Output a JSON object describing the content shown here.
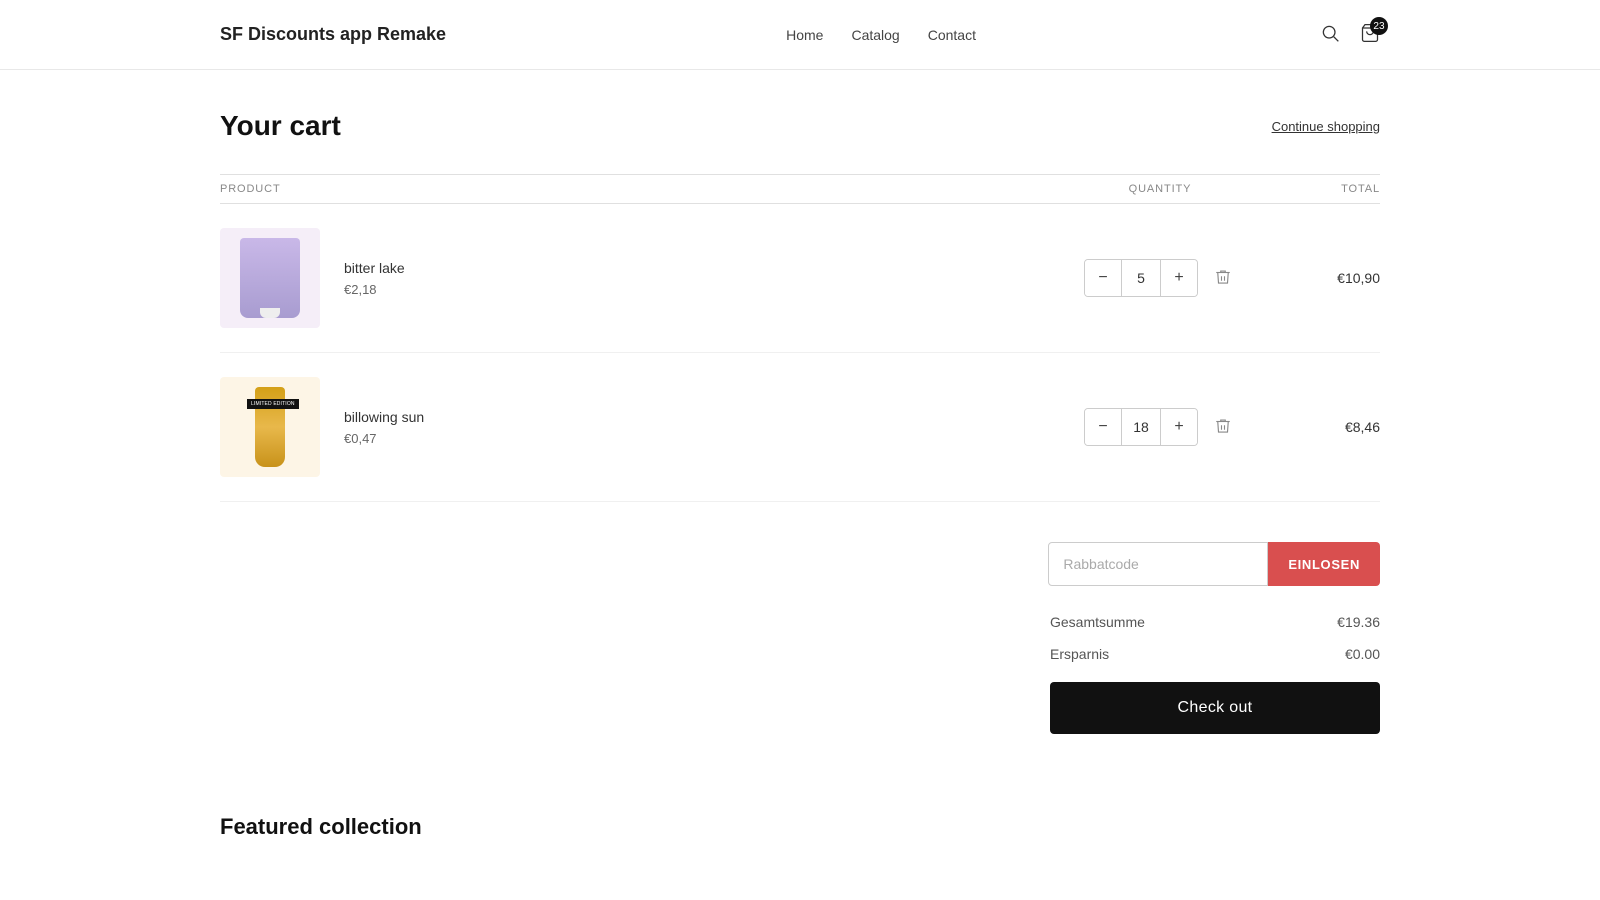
{
  "app": {
    "title": "SF Discounts app Remake"
  },
  "nav": {
    "links": [
      {
        "label": "Home",
        "id": "home"
      },
      {
        "label": "Catalog",
        "id": "catalog"
      },
      {
        "label": "Contact",
        "id": "contact"
      }
    ]
  },
  "cart": {
    "title": "Your cart",
    "continue_shopping": "Continue shopping",
    "columns": {
      "product": "PRODUCT",
      "quantity": "QUANTITY",
      "total": "TOTAL"
    },
    "items": [
      {
        "id": "bitter-lake",
        "name": "bitter lake",
        "price": "€2,18",
        "quantity": 5,
        "total": "€10,90"
      },
      {
        "id": "billowing-sun",
        "name": "billowing sun",
        "price": "€0,47",
        "quantity": 18,
        "total": "€8,46"
      }
    ],
    "discount": {
      "placeholder": "Rabbatcode",
      "button_label": "EINLOSEN"
    },
    "summary": {
      "gesamtsumme_label": "Gesamtsumme",
      "gesamtsumme_value": "€19.36",
      "ersparnis_label": "Ersparnis",
      "ersparnis_value": "€0.00"
    },
    "checkout_label": "Check out"
  },
  "featured": {
    "title": "Featured collection"
  },
  "icons": {
    "search": "🔍",
    "cart_count": "23"
  }
}
